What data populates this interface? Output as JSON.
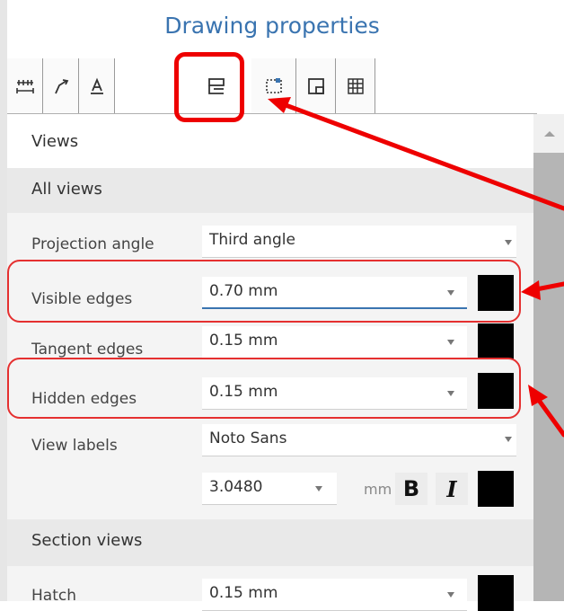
{
  "panel": {
    "title": "Drawing properties",
    "tabs": [
      {
        "name": "dimensions-tab-icon",
        "active": false
      },
      {
        "name": "leader-tab-icon",
        "active": false
      },
      {
        "name": "text-tab-icon",
        "active": false
      },
      {
        "name": "views-tab-icon",
        "active": true
      },
      {
        "name": "title-block-tab-icon",
        "active": false
      },
      {
        "name": "sheet-tab-icon",
        "active": false
      },
      {
        "name": "table-tab-icon",
        "active": false
      }
    ]
  },
  "views": {
    "header": "Views",
    "all_views_header": "All views",
    "projection_angle": {
      "label": "Projection angle",
      "value": "Third angle"
    },
    "visible_edges": {
      "label": "Visible edges",
      "value": "0.70 mm",
      "color": "#000000"
    },
    "tangent_edges": {
      "label": "Tangent edges",
      "value": "0.15 mm",
      "color": "#000000"
    },
    "hidden_edges": {
      "label": "Hidden edges",
      "value": "0.15 mm",
      "color": "#000000"
    },
    "view_labels": {
      "label": "View labels",
      "font": "Noto Sans",
      "size": "3.0480",
      "unit": "mm",
      "bold": "B",
      "italic": "I",
      "color": "#000000"
    },
    "section_views_header": "Section views",
    "hatch": {
      "label": "Hatch",
      "value": "0.15 mm"
    }
  },
  "colors": {
    "accent": "#3a74b0",
    "annotation": "#ee0000"
  }
}
